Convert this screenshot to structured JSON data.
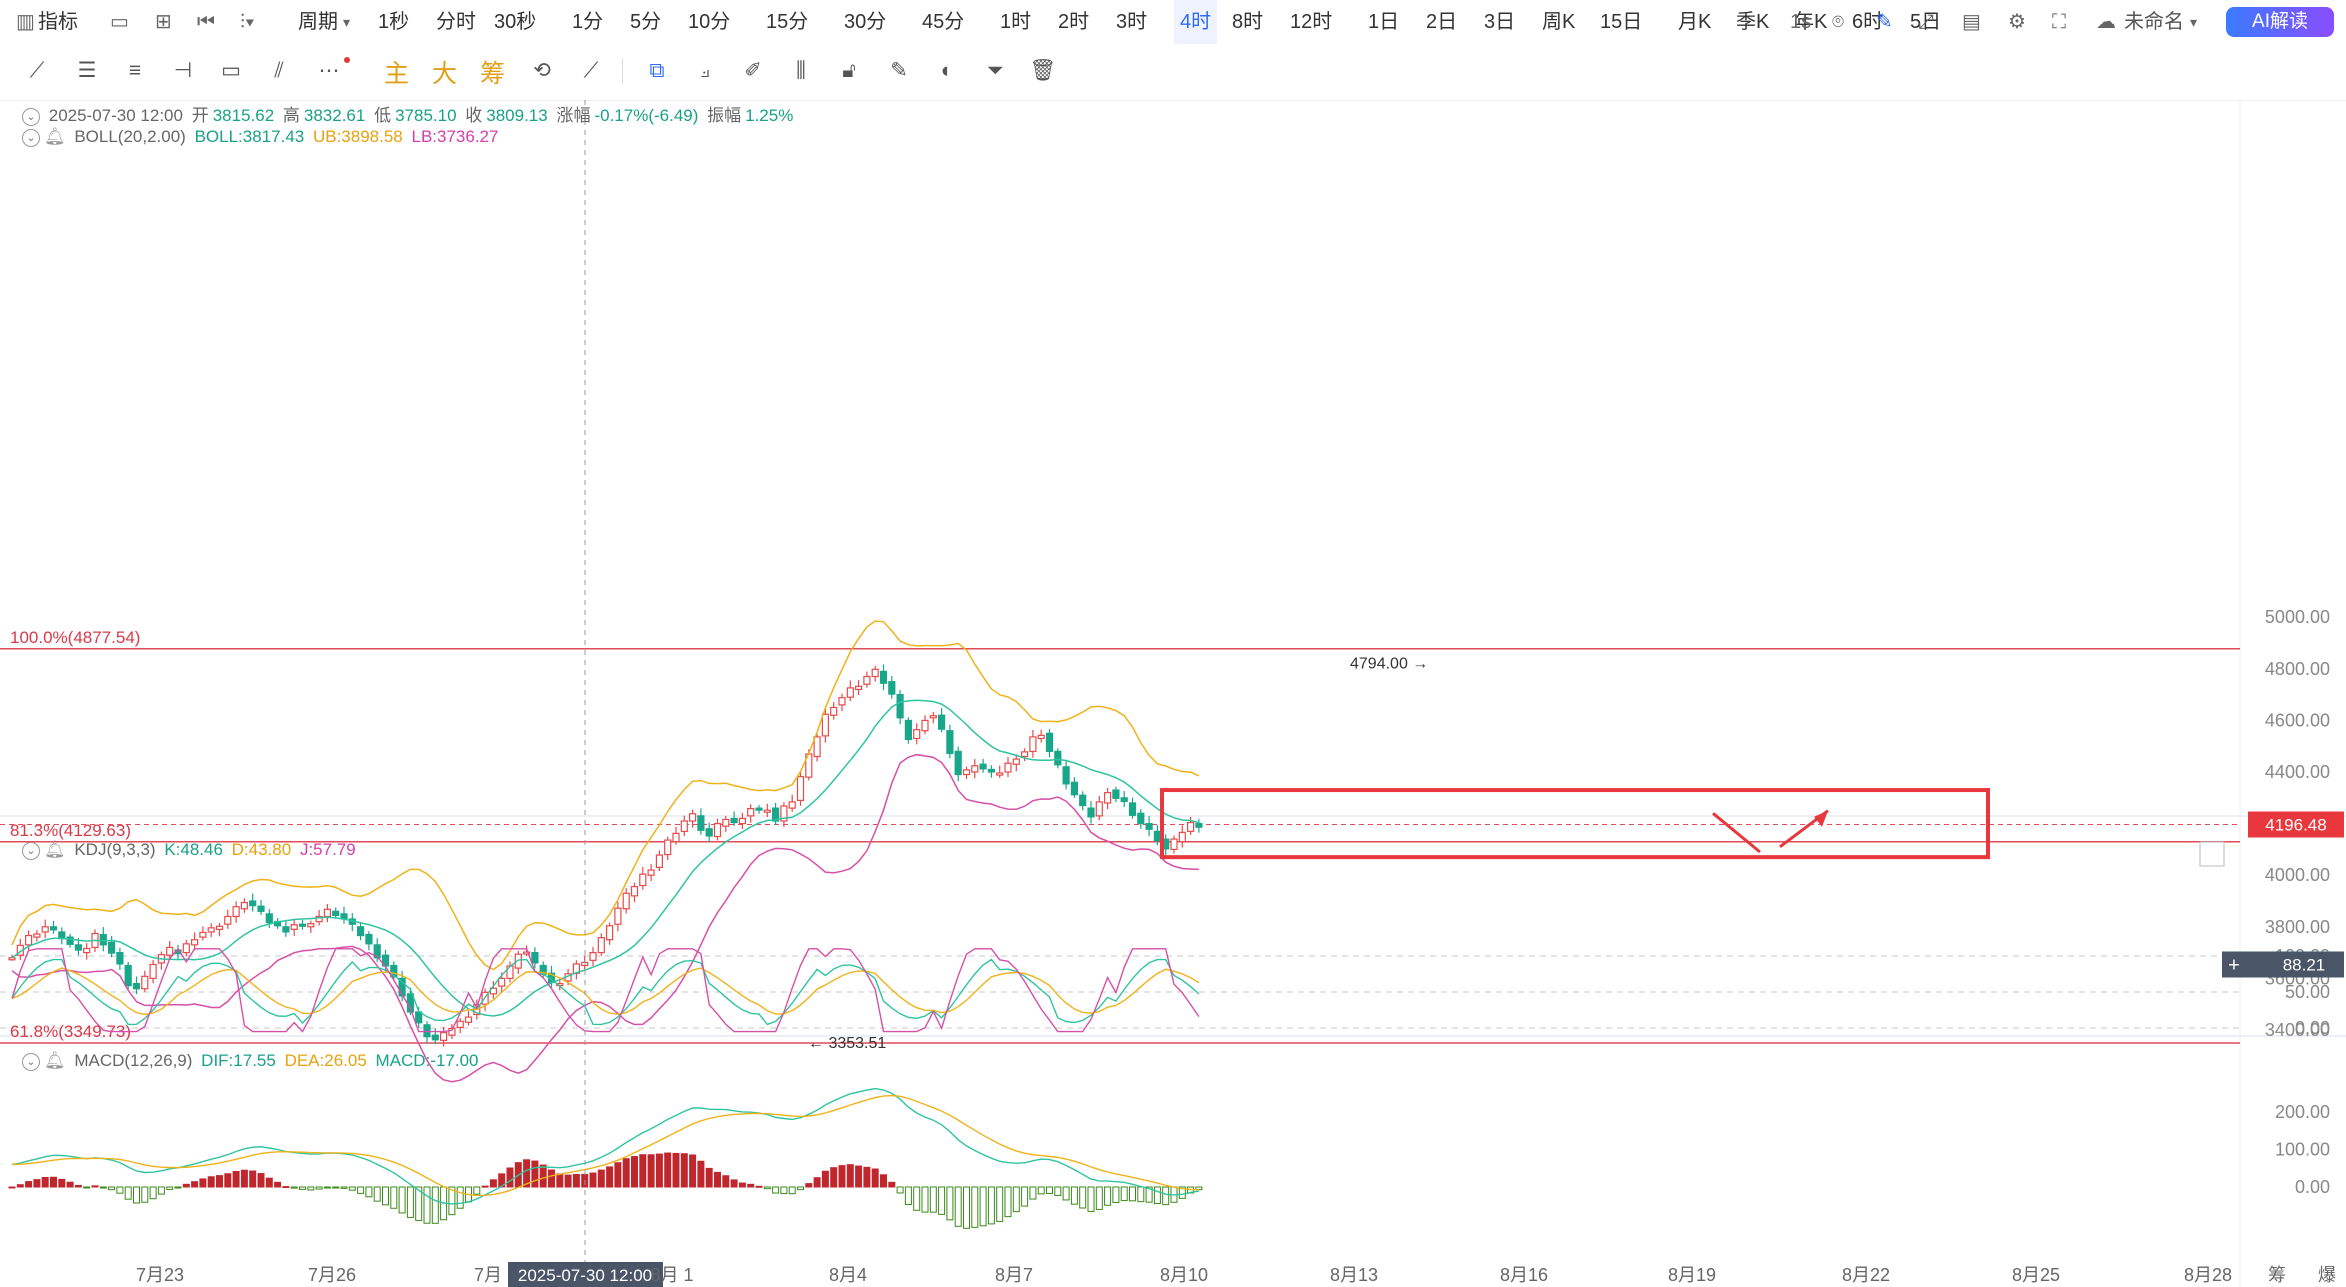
{
  "toolbar": {
    "indicator_label": "指标",
    "period_label": "周期",
    "periods": [
      "1秒",
      "分时",
      "30秒",
      "1分",
      "5分",
      "10分",
      "15分",
      "30分",
      "45分",
      "1时",
      "2时",
      "3时",
      "4时",
      "8时",
      "12时",
      "1日",
      "2日",
      "3日",
      "周K",
      "15日",
      "月K",
      "季K",
      "年K",
      "6时",
      "5日"
    ],
    "selected_period": "4时",
    "refresh": "1s",
    "unnamed": "未命名",
    "ai_button": "AI解读",
    "style_labels": [
      "主",
      "大",
      "筹"
    ]
  },
  "ohlc": {
    "date": "2025-07-30 12:00",
    "open_label": "开",
    "open": "3815.62",
    "high_label": "高",
    "high": "3832.61",
    "low_label": "低",
    "low": "3785.10",
    "close_label": "收",
    "close": "3809.13",
    "change_label": "涨幅",
    "change": "-0.17%(-6.49)",
    "amp_label": "振幅",
    "amp": "1.25%"
  },
  "boll": {
    "name": "BOLL(20,2.00)",
    "boll": "BOLL:3817.43",
    "ub": "UB:3898.58",
    "lb": "LB:3736.27"
  },
  "kdj": {
    "name": "KDJ(9,3,3)",
    "k": "K:48.46",
    "d": "D:43.80",
    "j": "J:57.79"
  },
  "macd": {
    "name": "MACD(12,26,9)",
    "dif": "DIF:17.55",
    "dea": "DEA:26.05",
    "macd": "MACD:-17.00"
  },
  "fib": {
    "top": "100.0%(4877.54)",
    "mid": "81.3%(4129.63)",
    "low": "61.8%(3349.73)"
  },
  "annotations": {
    "high": "4794.00",
    "low": "3353.51"
  },
  "price_badge": "4196.48",
  "kdj_badge": "88.21",
  "crosshair_time": "2025-07-30 12:00",
  "chart_data": {
    "type": "candlestick",
    "main_y_ticks": [
      3400,
      3600,
      3800,
      4000,
      4200,
      4400,
      4600,
      4800,
      5000
    ],
    "main_y_labels": [
      "3400.00",
      "3600.00",
      "3800.00",
      "4000.00",
      "4200.00",
      "4400.00",
      "4600.00",
      "4800.00",
      "5000.00"
    ],
    "kdj_y_labels": [
      "0.00",
      "50.00",
      "100.00"
    ],
    "macd_y_labels": [
      "0.00",
      "100.00",
      "200.00"
    ],
    "x_labels": [
      "7月23",
      "7月26",
      "7月",
      "8月 1",
      "8月4",
      "8月7",
      "8月10",
      "8月13",
      "8月16",
      "8月19",
      "8月22",
      "8月25",
      "8月28"
    ],
    "bottom_right_labels": [
      "筹",
      "爆"
    ],
    "price_path": [
      3690,
      3730,
      3760,
      3780,
      3800,
      3780,
      3760,
      3730,
      3700,
      3720,
      3770,
      3740,
      3700,
      3650,
      3580,
      3560,
      3600,
      3660,
      3690,
      3710,
      3700,
      3730,
      3760,
      3780,
      3790,
      3810,
      3840,
      3870,
      3900,
      3880,
      3850,
      3820,
      3800,
      3790,
      3810,
      3800,
      3820,
      3840,
      3860,
      3850,
      3830,
      3800,
      3770,
      3730,
      3690,
      3650,
      3600,
      3540,
      3470,
      3420,
      3380,
      3360,
      3380,
      3410,
      3430,
      3460,
      3500,
      3540,
      3570,
      3600,
      3640,
      3700,
      3700,
      3650,
      3620,
      3580,
      3590,
      3620,
      3650,
      3670,
      3700,
      3750,
      3810,
      3870,
      3920,
      3960,
      4000,
      4030,
      4080,
      4130,
      4170,
      4210,
      4230,
      4180,
      4150,
      4190,
      4220,
      4200,
      4230,
      4260,
      4250,
      4260,
      4210,
      4260,
      4290,
      4380,
      4460,
      4540,
      4620,
      4660,
      4690,
      4720,
      4740,
      4770,
      4790,
      4750,
      4700,
      4600,
      4530,
      4560,
      4610,
      4620,
      4560,
      4480,
      4390,
      4400,
      4430,
      4410,
      4390,
      4400,
      4430,
      4460,
      4480,
      4530,
      4550,
      4480,
      4420,
      4360,
      4310,
      4260,
      4230,
      4280,
      4330,
      4300,
      4280,
      4240,
      4200,
      4170,
      4140,
      4100,
      4130,
      4170,
      4200,
      4196
    ]
  }
}
